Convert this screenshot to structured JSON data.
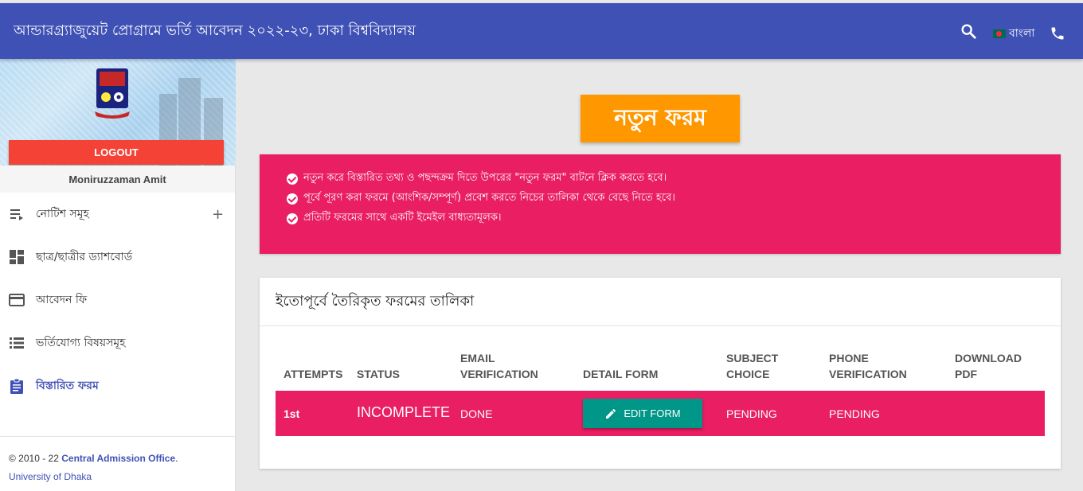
{
  "topbar": {
    "title": "আন্ডারগ্র্যাজুয়েট প্রোগ্রামে ভর্তি আবেদন ২০২২-২৩, ঢাকা বিশ্ববিদ্যালয়",
    "language_label": "বাংলা",
    "search_icon": "search-icon",
    "phone_icon": "phone-icon",
    "color": "#3f51b5"
  },
  "sidebar": {
    "logout_label": "LOGOUT",
    "username": "Moniruzzaman Amit",
    "items": [
      {
        "label": "নোটিশ সমূহ",
        "icon": "notice-list-icon",
        "has_expand": true,
        "expand_symbol": "+"
      },
      {
        "label": "ছাত্র/ছাত্রীর ড্যাশবোর্ড",
        "icon": "dashboard-icon"
      },
      {
        "label": "আবেদন ফি",
        "icon": "credit-card-icon"
      },
      {
        "label": "ভর্তিযোগ্য বিষয়সমূহ",
        "icon": "list-icon"
      },
      {
        "label": "বিস্তারিত ফরম",
        "icon": "clipboard-icon",
        "active": true
      }
    ],
    "footer": {
      "copyright": "© 2010 - 22",
      "office_link": "Central Admission Office",
      "period": ".",
      "university": "University of Dhaka"
    }
  },
  "main": {
    "new_form_label": "নতুন ফরম",
    "info_lines": [
      "নতুন করে বিস্তারিত তথ্য ও পছন্দক্রম দিতে উপরের \"নতুন ফরম\" বাটনে ক্লিক করতে হবে।",
      "পূর্বে পূরণ করা ফরমে (আংশিক/সম্পূর্ণ) প্রবেশ করতে নিচের তালিকা থেকে বেছে নিতে হবে।",
      "প্রতিটি ফরমের সাথে একটি ইমেইল বাধ্যতামূলক।"
    ],
    "table": {
      "title": "ইতোপূর্বে তৈরিকৃত ফরমের তালিকা",
      "headers": {
        "attempts": "ATTEMPTS",
        "status": "STATUS",
        "email_1": "EMAIL",
        "email_2": "VERIFICATION",
        "detail": "DETAIL FORM",
        "subject_1": "SUBJECT",
        "subject_2": "CHOICE",
        "phone_1": "PHONE",
        "phone_2": "VERIFICATION",
        "download_1": "DOWNLOAD",
        "download_2": "PDF"
      },
      "rows": [
        {
          "attempt": "1st",
          "status": "INCOMPLETE",
          "email_verification": "DONE",
          "action_label": "EDIT FORM",
          "subject_choice": "PENDING",
          "phone_verification": "PENDING",
          "download_pdf": ""
        }
      ]
    }
  },
  "colors": {
    "primary": "#3f51b5",
    "accent_pink": "#e91e63",
    "orange": "#ff9800",
    "teal": "#009688",
    "logout_red": "#f44336"
  }
}
